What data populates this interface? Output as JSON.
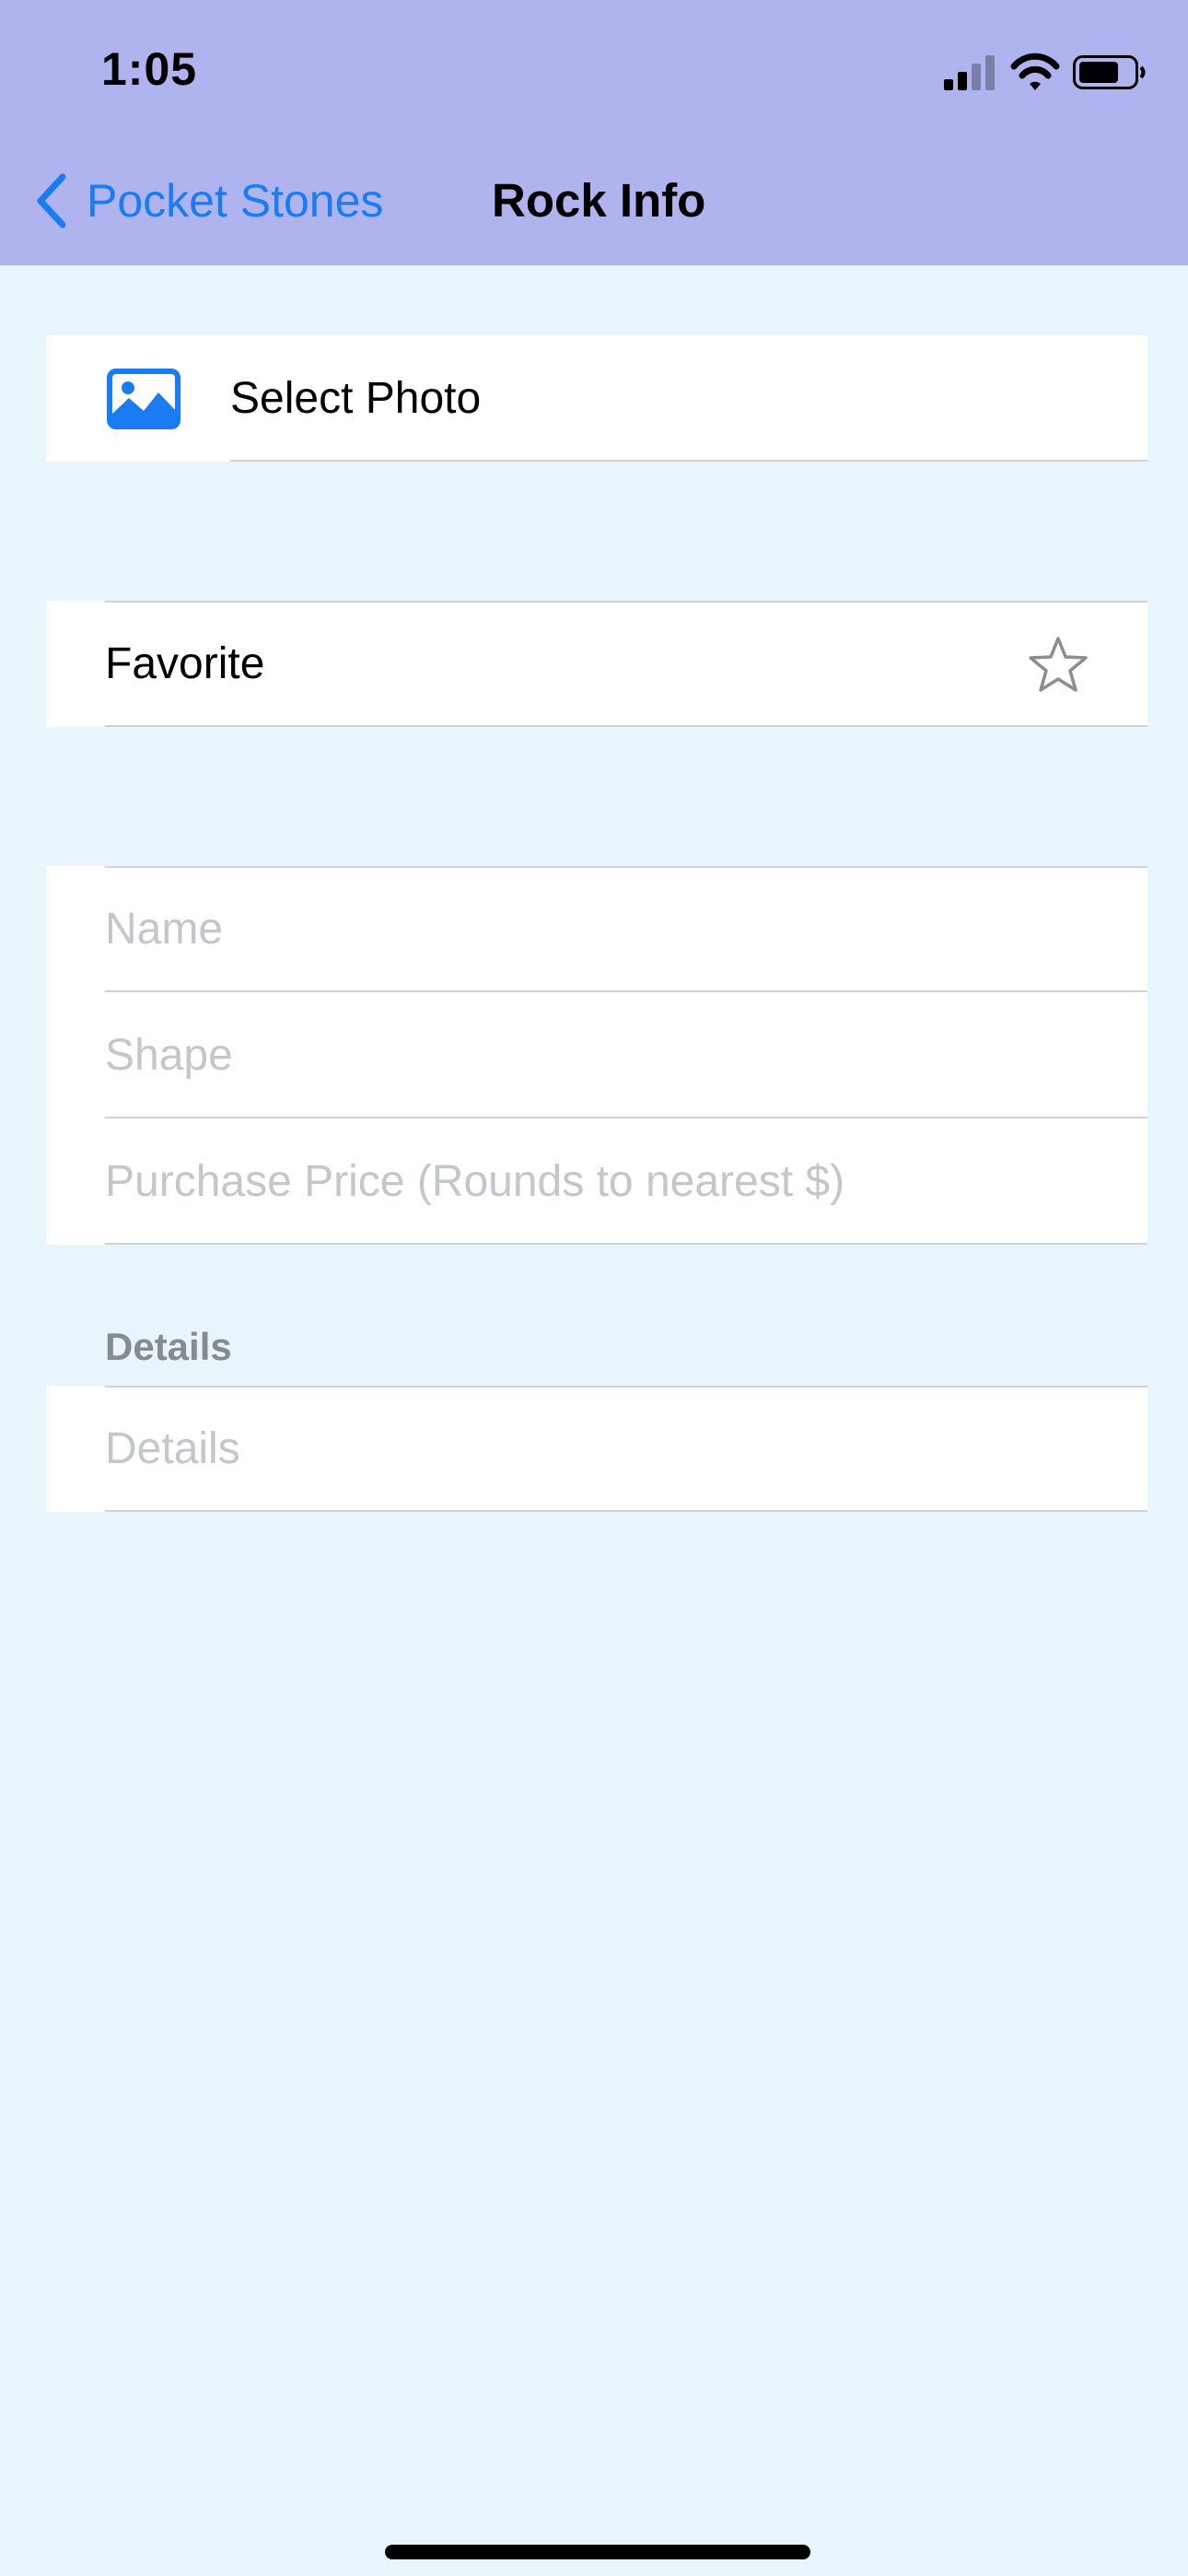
{
  "status_bar": {
    "time": "1:05"
  },
  "nav": {
    "back_label": "Pocket Stones",
    "title": "Rock Info"
  },
  "photo_row": {
    "label": "Select Photo",
    "icon": "photo-icon"
  },
  "favorite_row": {
    "label": "Favorite",
    "icon": "star-outline-icon"
  },
  "fields": {
    "name": {
      "placeholder": "Name"
    },
    "shape": {
      "placeholder": "Shape"
    },
    "price": {
      "placeholder": "Purchase Price (Rounds to nearest $)"
    }
  },
  "details": {
    "header": "Details",
    "placeholder": "Details"
  },
  "colors": {
    "header_bg": "#b0b4ee",
    "page_bg": "#e8f5fc",
    "accent": "#1a7cf5"
  }
}
